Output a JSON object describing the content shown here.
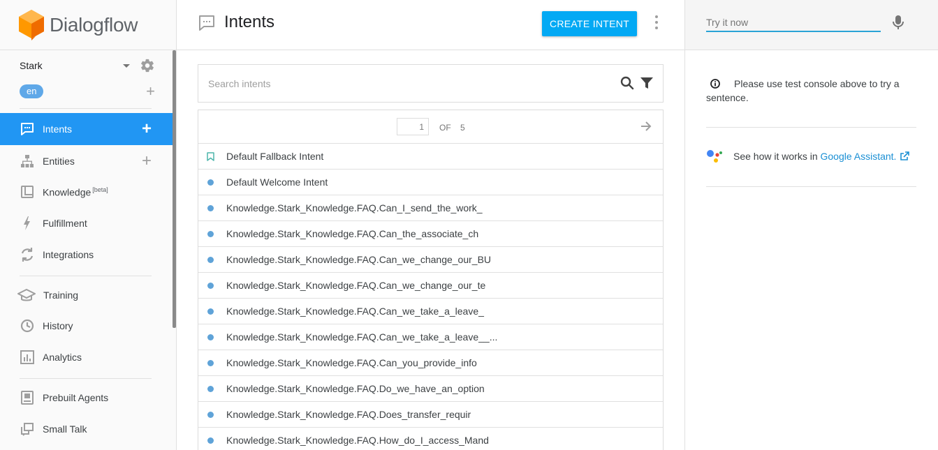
{
  "app": {
    "brand": "Dialogflow",
    "accent_color": "#2196f3",
    "button_color": "#03a9f4"
  },
  "sidebar": {
    "agent_name": "Stark",
    "language": "en",
    "items": [
      {
        "label": "Intents",
        "icon": "chat-bubble-icon",
        "active": true,
        "has_add": true
      },
      {
        "label": "Entities",
        "icon": "hierarchy-icon",
        "active": false,
        "has_add": true
      },
      {
        "label": "Knowledge",
        "badge": "[beta]",
        "icon": "book-icon",
        "active": false,
        "has_add": false
      },
      {
        "label": "Fulfillment",
        "icon": "lightning-icon",
        "active": false,
        "has_add": false
      },
      {
        "label": "Integrations",
        "icon": "sync-icon",
        "active": false,
        "has_add": false
      },
      {
        "label": "Training",
        "icon": "graduation-cap-icon",
        "active": false,
        "has_add": false
      },
      {
        "label": "History",
        "icon": "clock-icon",
        "active": false,
        "has_add": false
      },
      {
        "label": "Analytics",
        "icon": "bar-chart-icon",
        "active": false,
        "has_add": false
      },
      {
        "label": "Prebuilt Agents",
        "icon": "agent-book-icon",
        "active": false,
        "has_add": false
      },
      {
        "label": "Small Talk",
        "icon": "chat-windows-icon",
        "active": false,
        "has_add": false
      }
    ]
  },
  "main": {
    "title": "Intents",
    "create_button": "CREATE INTENT",
    "search_placeholder": "Search intents",
    "pager": {
      "current": "1",
      "of_label": "OF",
      "total": "5"
    },
    "intents": [
      {
        "name": "Default Fallback Intent",
        "marker": "bookmark"
      },
      {
        "name": "Default Welcome Intent",
        "marker": "dot"
      },
      {
        "name": "Knowledge.Stark_Knowledge.FAQ.Can_I_send_the_work_",
        "marker": "dot"
      },
      {
        "name": "Knowledge.Stark_Knowledge.FAQ.Can_the_associate_ch",
        "marker": "dot"
      },
      {
        "name": "Knowledge.Stark_Knowledge.FAQ.Can_we_change_our_BU",
        "marker": "dot"
      },
      {
        "name": "Knowledge.Stark_Knowledge.FAQ.Can_we_change_our_te",
        "marker": "dot"
      },
      {
        "name": "Knowledge.Stark_Knowledge.FAQ.Can_we_take_a_leave_",
        "marker": "dot"
      },
      {
        "name": "Knowledge.Stark_Knowledge.FAQ.Can_we_take_a_leave__...",
        "marker": "dot"
      },
      {
        "name": "Knowledge.Stark_Knowledge.FAQ.Can_you_provide_info",
        "marker": "dot"
      },
      {
        "name": "Knowledge.Stark_Knowledge.FAQ.Do_we_have_an_option",
        "marker": "dot"
      },
      {
        "name": "Knowledge.Stark_Knowledge.FAQ.Does_transfer_requir",
        "marker": "dot"
      },
      {
        "name": "Knowledge.Stark_Knowledge.FAQ.How_do_I_access_Mand",
        "marker": "dot"
      }
    ]
  },
  "right": {
    "try_placeholder": "Try it now",
    "info_text": "Please use test console above to try a sentence.",
    "assistant_text": "See how it works in ",
    "assistant_link": "Google Assistant."
  }
}
